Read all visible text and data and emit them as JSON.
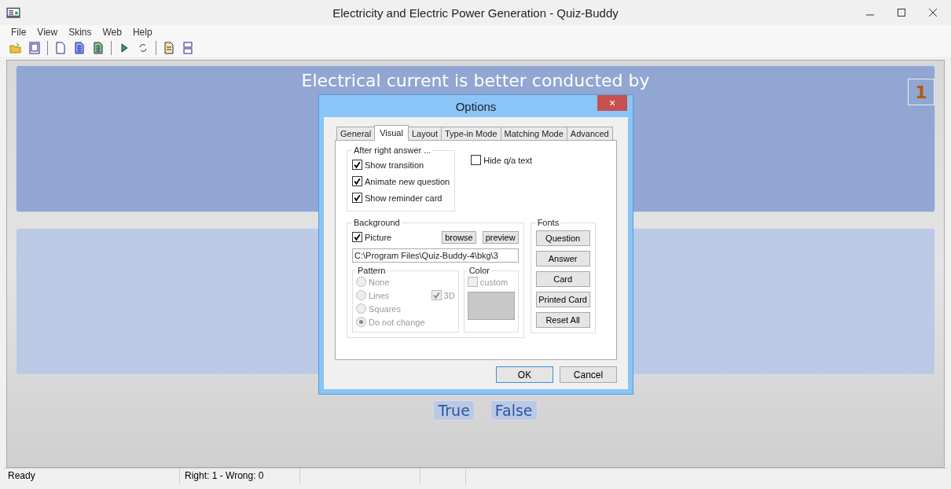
{
  "window": {
    "title": "Electricity and Electric Power Generation - Quiz-Buddy"
  },
  "menu": [
    "File",
    "View",
    "Skins",
    "Web",
    "Help"
  ],
  "question": {
    "text": "Electrical current is better conducted by",
    "counter": "1"
  },
  "answers": [
    {
      "label": "True"
    },
    {
      "label": "False"
    }
  ],
  "status_bar": [
    "Ready",
    "Right: 1 - Wrong: 0"
  ],
  "dialog": {
    "title": "Options",
    "close": "×",
    "tabs": [
      {
        "label": "General",
        "selected": false
      },
      {
        "label": "Visual",
        "selected": true
      },
      {
        "label": "Layout",
        "selected": false
      },
      {
        "label": "Type-in Mode",
        "selected": false
      },
      {
        "label": "Matching Mode",
        "selected": false
      },
      {
        "label": "Advanced",
        "selected": false
      }
    ],
    "after_right_answer": {
      "title": "After right answer ...",
      "options": [
        {
          "label": "Show transition",
          "checked": true
        },
        {
          "label": "Animate new question",
          "checked": true
        },
        {
          "label": "Show reminder card",
          "checked": true
        }
      ]
    },
    "hide_qa_text": {
      "label": "Hide q/a text",
      "checked": false
    },
    "background": {
      "title": "Background",
      "picture": {
        "label": "Picture",
        "checked": true
      },
      "browse": "browse",
      "preview": "preview",
      "path": "C:\\Program Files\\Quiz-Buddy-4\\bkg\\3",
      "pattern": {
        "title": "Pattern",
        "options": [
          {
            "label": "None",
            "selected": false
          },
          {
            "label": "Lines",
            "selected": false
          },
          {
            "label": "Squares",
            "selected": false
          },
          {
            "label": "Do not change",
            "selected": true
          }
        ],
        "three_d": {
          "label": "3D",
          "checked": true
        }
      },
      "color": {
        "title": "Color",
        "custom": {
          "label": "custom",
          "checked": false
        }
      }
    },
    "fonts": {
      "title": "Fonts",
      "buttons": [
        "Question",
        "Answer",
        "Card",
        "Printed Card",
        "Reset All"
      ]
    },
    "buttons": [
      "OK",
      "Cancel"
    ]
  }
}
